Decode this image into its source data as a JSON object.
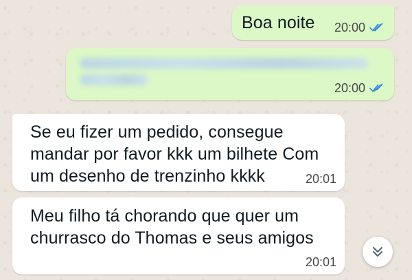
{
  "conversation": {
    "messages": [
      {
        "direction": "outgoing",
        "text": "Boa noite",
        "time": "20:00",
        "status_icon": "double-check-read-icon"
      },
      {
        "direction": "outgoing",
        "content": "blurred link",
        "time": "20:00",
        "status_icon": "double-check-read-icon"
      },
      {
        "direction": "incoming",
        "lines": [
          "Se eu fizer um pedido, consegue",
          "mandar por favor kkk um bilhete Com",
          "um desenho de trenzinho kkkk"
        ],
        "time": "20:01"
      },
      {
        "direction": "incoming",
        "lines": [
          "Meu filho tá chorando que quer um",
          "churrasco do Thomas e seus amigos"
        ],
        "time": "20:01"
      }
    ]
  },
  "scroll_button": {
    "icon": "double-chevron-down-icon"
  },
  "colors": {
    "wallpaper": "#ece5dd",
    "outgoing_bubble": "#dcf8c6",
    "incoming_bubble": "#ffffff",
    "read_ticks": "#34b7f1"
  }
}
